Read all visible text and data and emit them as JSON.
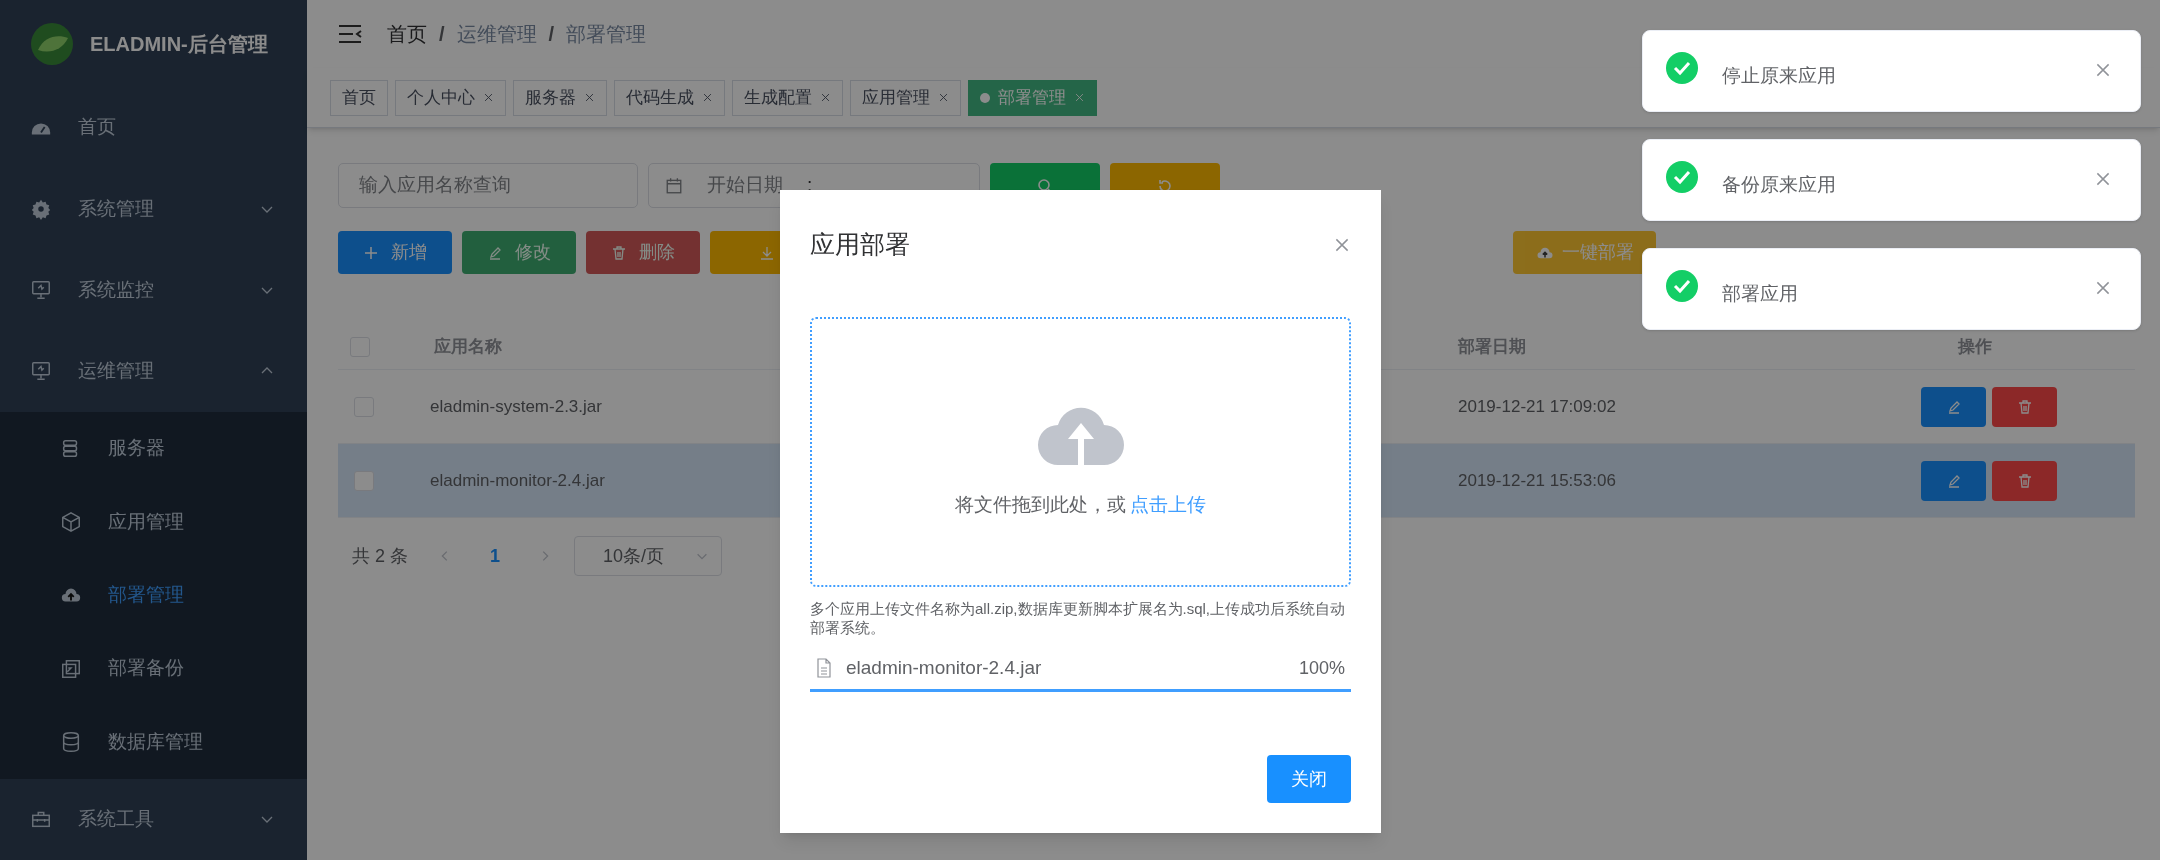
{
  "logo": {
    "title": "ELADMIN-后台管理"
  },
  "sidebar": {
    "items": [
      {
        "label": "首页",
        "kind": "dashboard",
        "selected": false
      },
      {
        "label": "系统管理",
        "kind": "gear",
        "selected": false,
        "expanded": false
      },
      {
        "label": "系统监控",
        "kind": "monitor",
        "selected": false,
        "expanded": false
      },
      {
        "label": "运维管理",
        "kind": "monitor",
        "selected": false,
        "expanded": true,
        "children": [
          {
            "label": "服务器",
            "kind": "server",
            "selected": false
          },
          {
            "label": "应用管理",
            "kind": "cube",
            "selected": false
          },
          {
            "label": "部署管理",
            "kind": "cloud",
            "selected": true
          },
          {
            "label": "部署备份",
            "kind": "copy",
            "selected": false
          },
          {
            "label": "数据库管理",
            "kind": "database",
            "selected": false
          }
        ]
      },
      {
        "label": "系统工具",
        "kind": "toolbox",
        "selected": false,
        "expanded": false
      }
    ]
  },
  "breadcrumb": {
    "separator": "/",
    "items": [
      "首页",
      "运维管理",
      "部署管理"
    ]
  },
  "tags": [
    {
      "label": "首页",
      "closable": false,
      "selected": false
    },
    {
      "label": "个人中心",
      "closable": true,
      "selected": false
    },
    {
      "label": "服务器",
      "closable": true,
      "selected": false
    },
    {
      "label": "代码生成",
      "closable": true,
      "selected": false
    },
    {
      "label": "生成配置",
      "closable": true,
      "selected": false
    },
    {
      "label": "应用管理",
      "closable": true,
      "selected": false
    },
    {
      "label": "部署管理",
      "closable": true,
      "selected": true
    }
  ],
  "filters": {
    "name_placeholder": "输入应用名称查询",
    "start_placeholder": "开始日期",
    "separator": ":"
  },
  "actions": [
    {
      "label": "新增",
      "kind": "add",
      "disabled": false
    },
    {
      "label": "修改",
      "kind": "edit",
      "disabled": true
    },
    {
      "label": "删除",
      "kind": "delete",
      "disabled": true
    },
    {
      "kind": "export",
      "disabled": false
    }
  ],
  "deploy_button": "一键部署",
  "table": {
    "select_all_checked": false,
    "columns": [
      "应用名称",
      "部署日期",
      "操作"
    ],
    "rows": [
      {
        "checked": false,
        "selected": false,
        "name": "eladmin-system-2.3.jar",
        "date": "2019-12-21 17:09:02"
      },
      {
        "checked": false,
        "selected": true,
        "name": "eladmin-monitor-2.4.jar",
        "date": "2019-12-21 15:53:06"
      }
    ]
  },
  "pagination": {
    "total": "共 2 条",
    "pages": [
      {
        "label": "1",
        "selected": true
      }
    ],
    "page_size": "10条/页"
  },
  "dialog": {
    "title": "应用部署",
    "drop_text": "将文件拖到此处，或",
    "drop_link": "点击上传",
    "tip": "多个应用上传文件名称为all.zip,数据库更新脚本扩展名为.sql,上传成功后系统自动部署系统。",
    "file": {
      "name": "eladmin-monitor-2.4.jar",
      "percent": "100%",
      "level": 1
    },
    "close": "关闭"
  },
  "notifications": [
    {
      "message": "停止原来应用"
    },
    {
      "message": "备份原来应用"
    },
    {
      "message": "部署应用"
    }
  ]
}
